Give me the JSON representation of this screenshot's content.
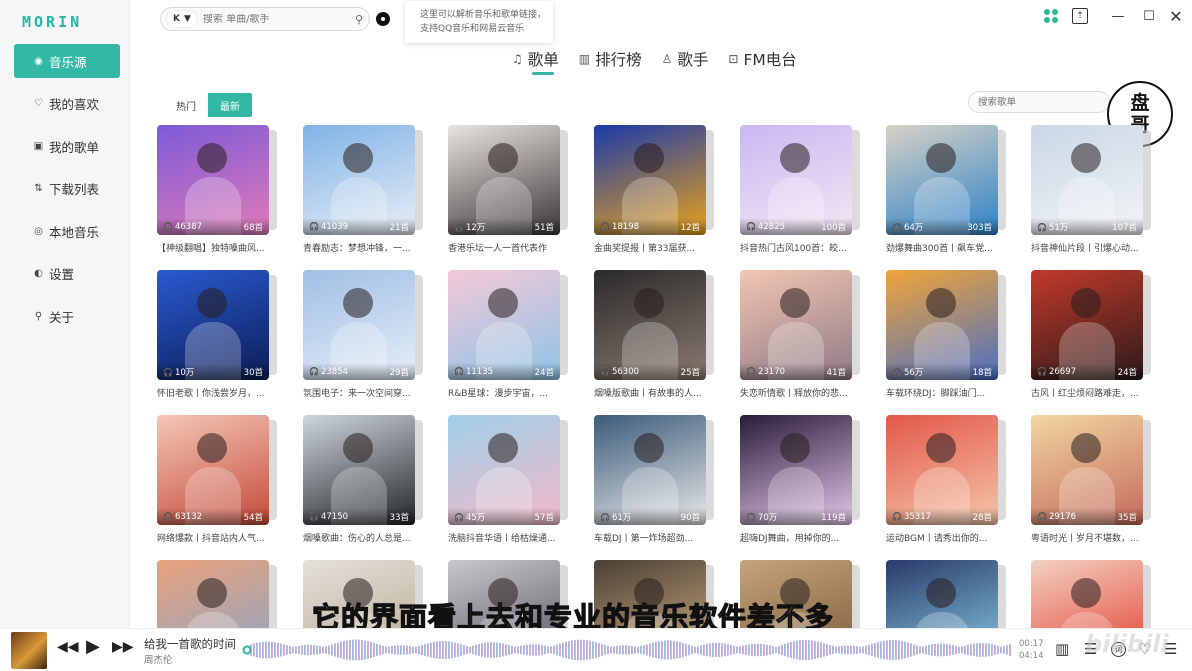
{
  "app": {
    "logo": "MORIN"
  },
  "sidebar": {
    "items": [
      {
        "label": "音乐源",
        "icon": "source-icon",
        "glyph": "◉",
        "active": true
      },
      {
        "label": "我的喜欢",
        "icon": "heart-icon",
        "glyph": "♡",
        "active": false
      },
      {
        "label": "我的歌单",
        "icon": "playlist-icon",
        "glyph": "▣",
        "active": false
      },
      {
        "label": "下载列表",
        "icon": "download-icon",
        "glyph": "⇅",
        "active": false
      },
      {
        "label": "本地音乐",
        "icon": "local-music-icon",
        "glyph": "◎",
        "active": false
      },
      {
        "label": "设置",
        "icon": "settings-icon",
        "glyph": "◐",
        "active": false
      },
      {
        "label": "关于",
        "icon": "about-icon",
        "glyph": "⚲",
        "active": false
      }
    ]
  },
  "search": {
    "source": "K",
    "placeholder": "搜索 单曲/歌手"
  },
  "tooltip": {
    "line1": "这里可以解析音乐和歌单链接，",
    "line2": "支持QQ音乐和网易云音乐"
  },
  "tabs": [
    {
      "label": "歌单",
      "glyph": "♫",
      "active": true
    },
    {
      "label": "排行榜",
      "glyph": "▥",
      "active": false
    },
    {
      "label": "歌手",
      "glyph": "♙",
      "active": false
    },
    {
      "label": "FM电台",
      "glyph": "⊡",
      "active": false
    }
  ],
  "filter": {
    "hot": "热门",
    "latest": "最新"
  },
  "playlist_search": {
    "placeholder": "搜索歌单"
  },
  "badge": {
    "line1": "盘",
    "line2": "哥"
  },
  "playlists": [
    {
      "plays": "46387",
      "count": "68首",
      "title": "【神级翻唱】独特嗓曲风...",
      "c1": "#7b5bd6",
      "c2": "#e07ab8"
    },
    {
      "plays": "41039",
      "count": "21首",
      "title": "青春励志：梦想冲锋，一...",
      "c1": "#7fb3e6",
      "c2": "#e9eef5"
    },
    {
      "plays": "12万",
      "count": "51首",
      "title": "香港乐坛一人一首代表作",
      "c1": "#e8e4e0",
      "c2": "#3a3636"
    },
    {
      "plays": "18198",
      "count": "12首",
      "title": "金曲奖提报丨第33届获...",
      "c1": "#1a3aa8",
      "c2": "#e8a21c"
    },
    {
      "plays": "42825",
      "count": "100首",
      "title": "抖音热门古风100首：皎...",
      "c1": "#c9b8f2",
      "c2": "#f4e6f3"
    },
    {
      "plays": "64万",
      "count": "303首",
      "title": "劲爆舞曲300首丨飙车党...",
      "c1": "#d6d2c6",
      "c2": "#2c83c7"
    },
    {
      "plays": "51万",
      "count": "107首",
      "title": "抖音神仙片段丨引爆心动...",
      "c1": "#c9d7e6",
      "c2": "#f2f4f6"
    },
    {
      "plays": "10万",
      "count": "30首",
      "title": "怀旧老歌丨你浅尝岁月，...",
      "c1": "#2a5bd1",
      "c2": "#0c1c55"
    },
    {
      "plays": "23854",
      "count": "29首",
      "title": "氛围电子：来一次空间穿...",
      "c1": "#9fbfe4",
      "c2": "#e6eef7"
    },
    {
      "plays": "11135",
      "count": "24首",
      "title": "R&B星球：漫步宇宙，...",
      "c1": "#f3c9d7",
      "c2": "#8ec3e6"
    },
    {
      "plays": "56300",
      "count": "25首",
      "title": "烟嗓版歌曲丨有故事的人...",
      "c1": "#2a2a2a",
      "c2": "#8a7a70"
    },
    {
      "plays": "23170",
      "count": "41首",
      "title": "失恋听情歌丨释放你的悲...",
      "c1": "#f2c6b2",
      "c2": "#8f7a86"
    },
    {
      "plays": "56万",
      "count": "18首",
      "title": "车载环绕DJ：脚踩油门...",
      "c1": "#f0a53a",
      "c2": "#4a6fc2"
    },
    {
      "plays": "26697",
      "count": "24首",
      "title": "古风丨红尘烦闷路难走，...",
      "c1": "#c23a2a",
      "c2": "#2a1a1a"
    },
    {
      "plays": "63132",
      "count": "54首",
      "title": "网络爆款丨抖音站内人气...",
      "c1": "#f4c7b6",
      "c2": "#c44a3a"
    },
    {
      "plays": "47150",
      "count": "33首",
      "title": "烟嗓歌曲：伤心的人总是...",
      "c1": "#cfd6dc",
      "c2": "#22262a"
    },
    {
      "plays": "45万",
      "count": "57首",
      "title": "洗脑抖音华语丨给枯燥通...",
      "c1": "#9fd0e8",
      "c2": "#f2b8c8"
    },
    {
      "plays": "61万",
      "count": "90首",
      "title": "车载DJ丨第一炸场超劲...",
      "c1": "#3b5b7a",
      "c2": "#e8e8e8"
    },
    {
      "plays": "70万",
      "count": "119首",
      "title": "超嗨DJ舞曲，用掉你的...",
      "c1": "#2a1a3a",
      "c2": "#e4c8e8"
    },
    {
      "plays": "35317",
      "count": "28首",
      "title": "运动BGM丨请秀出你的...",
      "c1": "#e2584a",
      "c2": "#f4c6a8"
    },
    {
      "plays": "29176",
      "count": "35首",
      "title": "粤语时光丨岁月不堪数，...",
      "c1": "#f2d6a2",
      "c2": "#c46a5a"
    },
    {
      "plays": "",
      "count": "",
      "title": "",
      "c1": "#e8a27a",
      "c2": "#8aa6c9"
    },
    {
      "plays": "",
      "count": "",
      "title": "",
      "c1": "#e4e0da",
      "c2": "#b8a890"
    },
    {
      "plays": "",
      "count": "",
      "title": "",
      "c1": "#c8c8cc",
      "c2": "#55505a"
    },
    {
      "plays": "",
      "count": "",
      "title": "",
      "c1": "#4a4036",
      "c2": "#d6b282"
    },
    {
      "plays": "",
      "count": "",
      "title": "",
      "c1": "#c4a47a",
      "c2": "#7a5a3a"
    },
    {
      "plays": "",
      "count": "",
      "title": "",
      "c1": "#2a3a6a",
      "c2": "#8ad0ea"
    },
    {
      "plays": "",
      "count": "",
      "title": "",
      "c1": "#f2d2c2",
      "c2": "#e23a2a"
    }
  ],
  "subtitle": "它的界面看上去和专业的音乐软件差不多",
  "player": {
    "song": "给我一首歌的时间",
    "artist": "周杰伦",
    "current_time": "00:17",
    "total_time": "04:14",
    "lyric_label": "词",
    "progress": 0.005,
    "wave_colors": [
      "#7ed6d0",
      "#b9a4f0",
      "#f2b6dc"
    ]
  },
  "watermark": "bilibili"
}
